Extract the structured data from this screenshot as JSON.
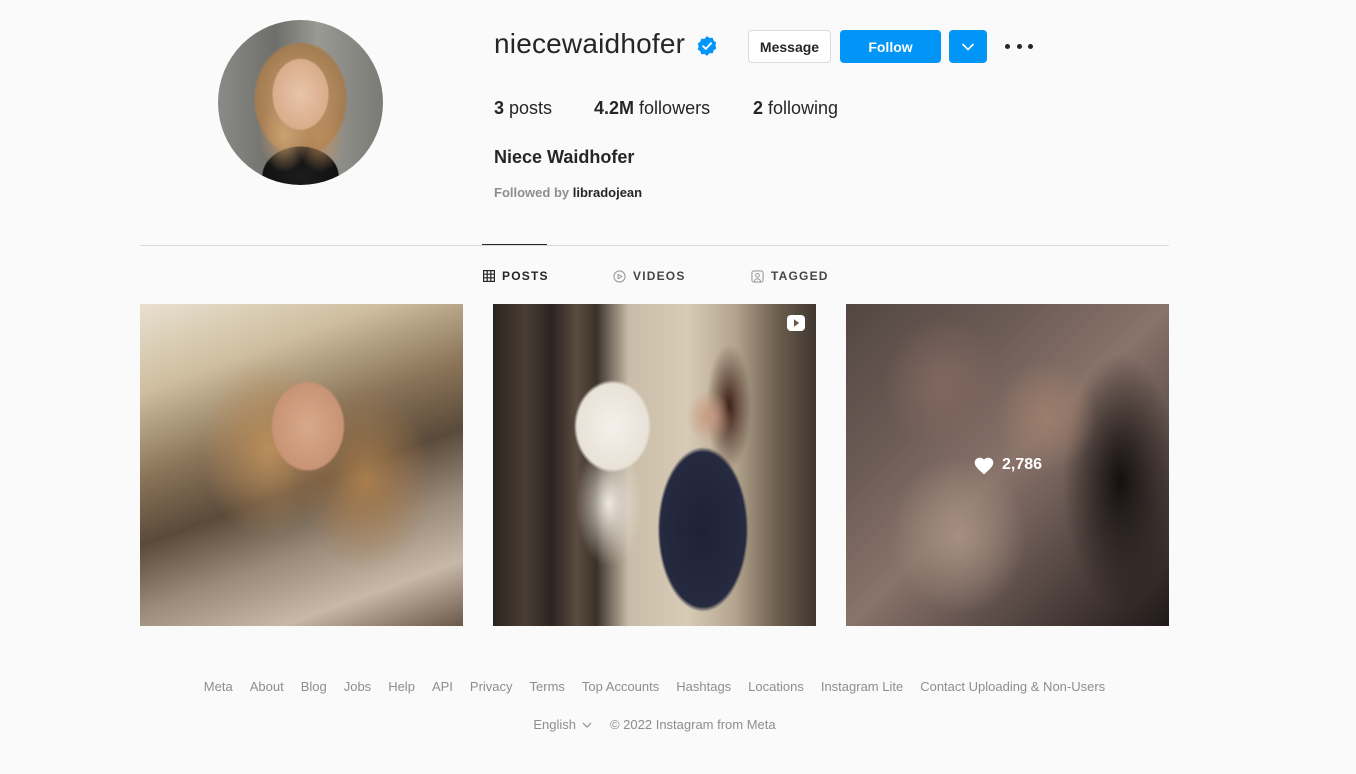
{
  "profile": {
    "username": "niecewaidhofer",
    "full_name": "Niece Waidhofer",
    "verified": true,
    "followed_by_prefix": "Followed by",
    "followed_by_user": "libradojean"
  },
  "actions": {
    "message_label": "Message",
    "follow_label": "Follow"
  },
  "stats": {
    "posts_count": "3",
    "posts_label": "posts",
    "followers_count": "4.2M",
    "followers_label": "followers",
    "following_count": "2",
    "following_label": "following"
  },
  "tabs": [
    {
      "label": "POSTS",
      "icon": "grid-icon",
      "active": true
    },
    {
      "label": "VIDEOS",
      "icon": "play-circle-icon",
      "active": false
    },
    {
      "label": "TAGGED",
      "icon": "tagged-icon",
      "active": false
    }
  ],
  "posts": [
    {
      "type": "photo"
    },
    {
      "type": "video",
      "icon": "video-play-icon"
    },
    {
      "type": "photo",
      "hover_likes": "2,786"
    }
  ],
  "footer": {
    "links": [
      "Meta",
      "About",
      "Blog",
      "Jobs",
      "Help",
      "API",
      "Privacy",
      "Terms",
      "Top Accounts",
      "Hashtags",
      "Locations",
      "Instagram Lite",
      "Contact Uploading & Non-Users"
    ],
    "language": "English",
    "copyright": "© 2022 Instagram from Meta"
  },
  "colors": {
    "accent": "#0095f6",
    "background": "#fafafa",
    "text": "#262626",
    "muted": "#8e8e8e",
    "border": "#dbdbdb"
  }
}
